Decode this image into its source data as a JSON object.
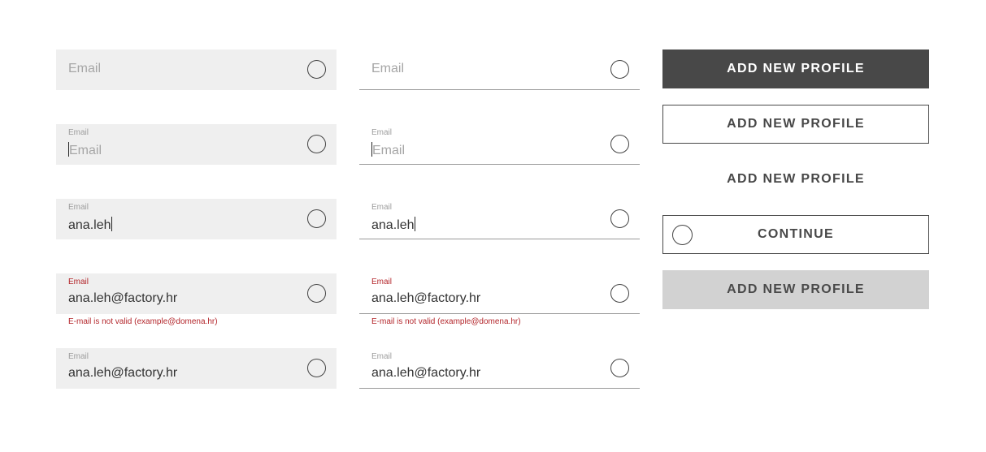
{
  "fields": {
    "label": "Email",
    "placeholder": "Email",
    "typing_value": "ana.leh",
    "full_value": "ana.leh@factory.hr",
    "error_message": "E-mail is not valid (example@domena.hr)"
  },
  "buttons": {
    "primary": "ADD NEW PROFILE",
    "outlined": "ADD NEW PROFILE",
    "text": "ADD NEW PROFILE",
    "continue": "CONTINUE",
    "disabled": "ADD NEW PROFILE"
  },
  "colors": {
    "error": "#b3262b",
    "primary_button": "#484848",
    "disabled_button": "#d2d2d2",
    "filled_field": "#efefef"
  }
}
